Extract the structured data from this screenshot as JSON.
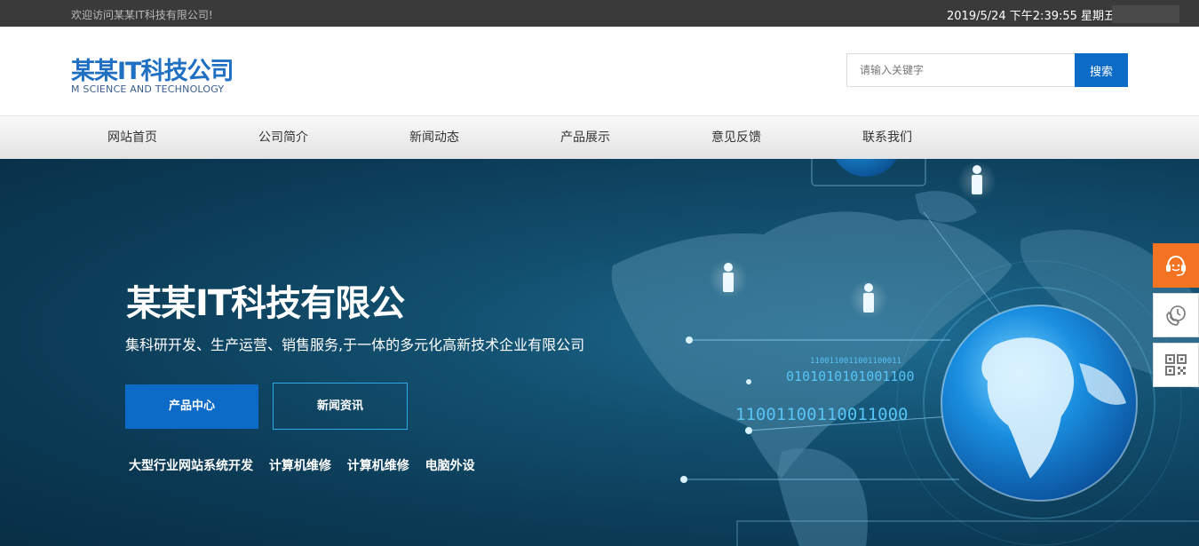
{
  "topbar": {
    "welcome": "欢迎访问某某IT科技有限公司!",
    "datetime": "2019/5/24 下午2:39:55 星期五"
  },
  "header": {
    "logo_name": "某某IT科技公司",
    "logo_sub": "M SCIENCE AND TECHNOLOGY",
    "search_placeholder": "请输入关键字",
    "search_button": "搜索"
  },
  "nav": {
    "items": [
      {
        "label": "网站首页"
      },
      {
        "label": "公司简介"
      },
      {
        "label": "新闻动态"
      },
      {
        "label": "产品展示"
      },
      {
        "label": "意见反馈"
      },
      {
        "label": "联系我们"
      }
    ]
  },
  "banner": {
    "title": "某某IT科技有限公",
    "subtitle": "集科研开发、生产运营、销售服务,于一体的多元化高新技术企业有限公司",
    "btn_primary": "产品中心",
    "btn_secondary": "新闻资讯",
    "tags": [
      "大型行业网站系统开发",
      "计算机维修",
      "计算机维修",
      "电脑外设"
    ],
    "binary": [
      "1100110011001100011",
      "0101010101001100",
      "11001100110011000"
    ]
  },
  "side_tools": [
    {
      "icon": "customer-service-icon"
    },
    {
      "icon": "phone-icon"
    },
    {
      "icon": "qrcode-icon"
    }
  ],
  "colors": {
    "brand_blue": "#1f6fc2",
    "button_blue": "#0b6bc6",
    "topbar_bg": "#3a3a3a",
    "service_orange": "#f27321"
  }
}
